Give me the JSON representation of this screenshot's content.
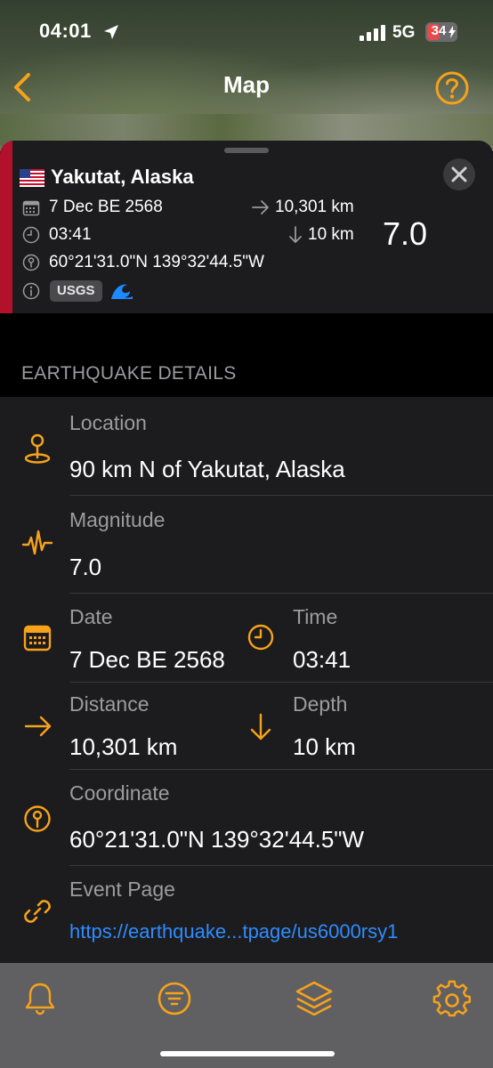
{
  "status_bar": {
    "time": "04:01",
    "network": "5G",
    "battery": "34"
  },
  "nav": {
    "title": "Map"
  },
  "summary": {
    "place": "Yakutat, Alaska",
    "date": "7 Dec BE 2568",
    "time": "03:41",
    "distance": "10,301 km",
    "depth": "10 km",
    "coordinate": "60°21'31.0\"N 139°32'44.5\"W",
    "source": "USGS",
    "magnitude": "7.0",
    "accent_color": "#b2102b"
  },
  "section": {
    "title": "EARTHQUAKE DETAILS"
  },
  "details": {
    "location_label": "Location",
    "location_value": "90 km N of Yakutat, Alaska",
    "magnitude_label": "Magnitude",
    "magnitude_value": "7.0",
    "date_label": "Date",
    "date_value": "7 Dec BE 2568",
    "time_label": "Time",
    "time_value": "03:41",
    "distance_label": "Distance",
    "distance_value": "10,301 km",
    "depth_label": "Depth",
    "depth_value": "10 km",
    "coordinate_label": "Coordinate",
    "coordinate_value": "60°21'31.0\"N 139°32'44.5\"W",
    "event_label": "Event Page",
    "event_value": "https://earthquake...tpage/us6000rsy1"
  },
  "tabbar": {
    "tabs": [
      "bell-icon",
      "filter-icon",
      "layers-icon",
      "gear-icon"
    ]
  },
  "colors": {
    "accent": "#f7a21b",
    "link": "#2f8cff"
  }
}
